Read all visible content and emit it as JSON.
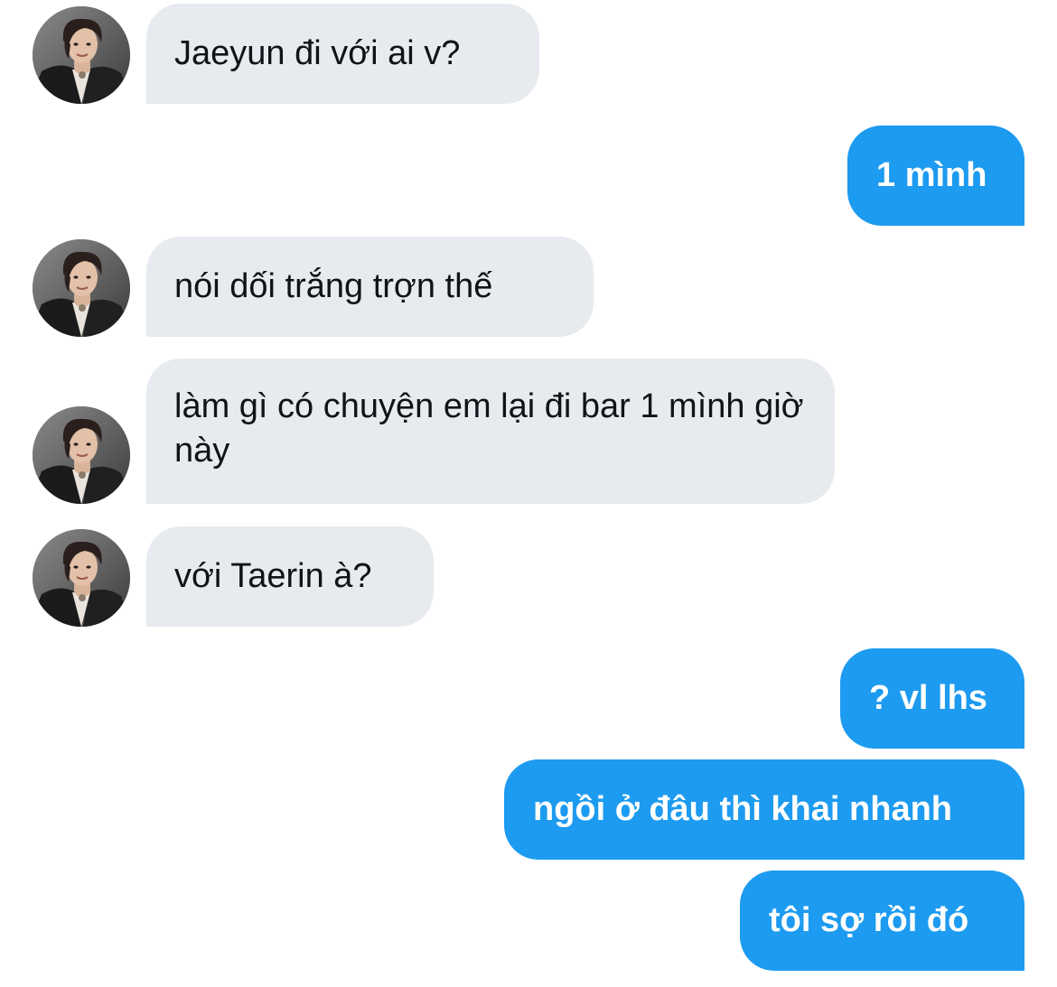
{
  "conversation": {
    "messages": [
      {
        "from": "them",
        "text": "Jaeyun đi với ai v?"
      },
      {
        "from": "me",
        "text": "1 mình"
      },
      {
        "from": "them",
        "text": "nói dối trắng trợn thế"
      },
      {
        "from": "them",
        "text": "làm gì có chuyện em lại đi bar 1 mình giờ này"
      },
      {
        "from": "them",
        "text": "với Taerin à?"
      },
      {
        "from": "me",
        "text": "? vl lhs"
      },
      {
        "from": "me",
        "text": "ngồi ở đâu thì khai nhanh"
      },
      {
        "from": "me",
        "text": "tôi sợ rồi đó"
      }
    ]
  },
  "colors": {
    "incoming_bubble": "#e7ebef",
    "outgoing_bubble": "#1d9bf0",
    "incoming_text": "#0f1419",
    "outgoing_text": "#ffffff"
  }
}
